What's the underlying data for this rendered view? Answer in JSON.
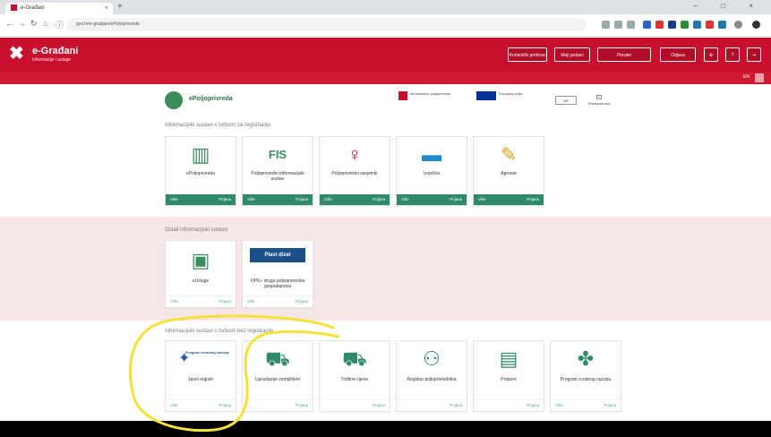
{
  "browser": {
    "tab_title": "e-Građani",
    "url": "gov.hr/e-gradjani/ePoljoprivreda",
    "new_tab": "+",
    "window_controls": "– □ ×",
    "nav": {
      "back": "←",
      "forward": "→",
      "reload": "↻",
      "home": "⌂",
      "info": "ⓘ"
    }
  },
  "header": {
    "title": "e-Građani",
    "subtitle": "Informacije i usluge",
    "buttons": [
      "Korisnički pretinac",
      "Moji podaci",
      "Poruke",
      "Odjava"
    ],
    "lang": "EN",
    "logo": "grid-logo-icon"
  },
  "portal": {
    "title": "ePoljoprivreda",
    "eu_left": "Ministarstvo poljoprivrede",
    "eu_right": "Europska unija",
    "lang_select": "HR",
    "accessibility": "Pristupačnost"
  },
  "sections": {
    "s1": {
      "title": "Informacijski sustavi s točkom za registraciju",
      "cards": [
        {
          "label": "ePoljoprivreda",
          "foot_l": "Više",
          "foot_r": "Prijava",
          "icon": "chart-icon",
          "color": "#3a8d5c"
        },
        {
          "label": "Poljoprivredni informacijski sustav",
          "foot_l": "Više",
          "foot_r": "Prijava",
          "icon": "fis-logo-icon",
          "color": "#3a8d5c"
        },
        {
          "label": "Poljoprivredni savjetnik",
          "foot_l": "Više",
          "foot_r": "Prijava",
          "icon": "person-icon",
          "color": "#c8102e"
        },
        {
          "label": "Izvješća",
          "foot_l": "Više",
          "foot_r": "Prijava",
          "icon": "landscape-icon",
          "color": "#1e88c8"
        },
        {
          "label": "Agronet",
          "foot_l": "Više",
          "foot_r": "Prijava",
          "icon": "bulb-icon",
          "color": "#e0a020"
        }
      ]
    },
    "s2": {
      "title": "Ostali informacijski sustavi",
      "cards": [
        {
          "label": "eUsluge",
          "foot_l": "Više",
          "foot_r": "Prijava",
          "icon": "monitor-icon",
          "color": "#3a8d5c"
        },
        {
          "label": "OPG i druga poljoprivredna gospodarstva",
          "foot_l": "Više",
          "foot_r": "Prijava",
          "icon": "badge-icon",
          "color": "#1a4f8a",
          "badge": "Plavi dizel"
        }
      ]
    },
    "s3": {
      "title": "Informacijski sustavi s točkom bez registracije",
      "cards": [
        {
          "label": "Javni registri",
          "foot_l": "Više",
          "foot_r": "Prijava",
          "icon": "eu-logo-icon",
          "color": "#1e5aa8",
          "logo_text": "Program ruralnog razvoja"
        },
        {
          "label": "Upravljanje zemljištem",
          "foot_l": "",
          "foot_r": "Prijava",
          "icon": "tractor-icon",
          "color": "#2f8a6a"
        },
        {
          "label": "Tržišne cijene",
          "foot_l": "",
          "foot_r": "Prijava",
          "icon": "tractor-icon",
          "color": "#2f8a6a"
        },
        {
          "label": "Registar poljoprivrednika",
          "foot_l": "",
          "foot_r": "Prijava",
          "icon": "user-icon",
          "color": "#2f8a6a"
        },
        {
          "label": "Potpore",
          "foot_l": "",
          "foot_r": "Prijava",
          "icon": "document-icon",
          "color": "#2f8a6a"
        },
        {
          "label": "Program ruralnog razvoja",
          "foot_l": "Više",
          "foot_r": "Prijava",
          "icon": "clover-icon",
          "color": "#2f8a6a"
        }
      ]
    }
  }
}
